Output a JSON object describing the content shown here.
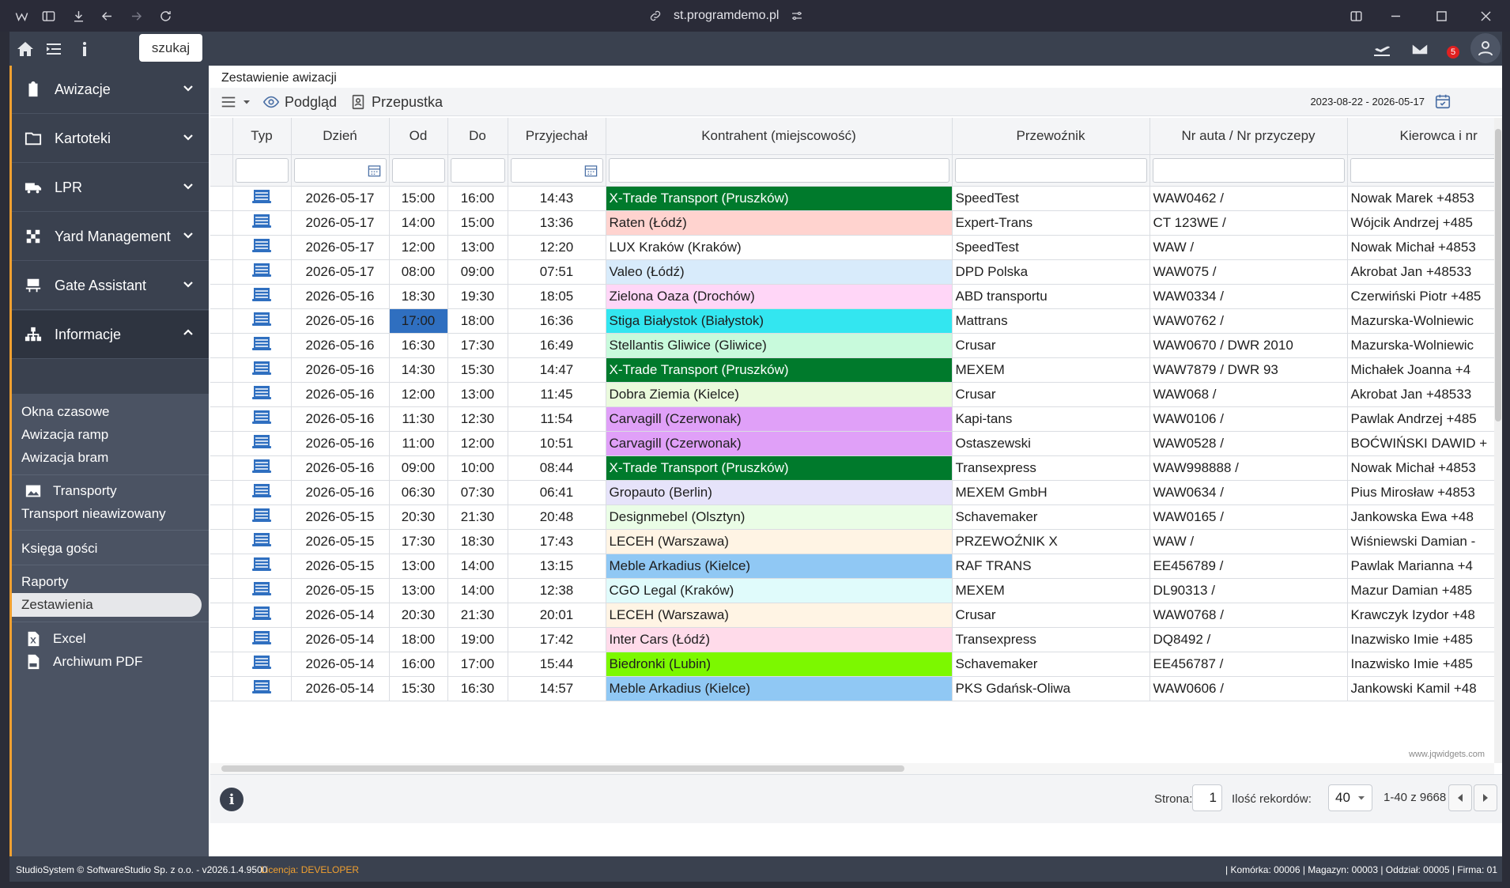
{
  "browser": {
    "url": "st.programdemo.pl"
  },
  "app": {
    "search_label": "szukaj",
    "mail_count": "5"
  },
  "sidebar": {
    "items": [
      {
        "label": "Awizacje"
      },
      {
        "label": "Kartoteki"
      },
      {
        "label": "LPR"
      },
      {
        "label": "Yard Management"
      },
      {
        "label": "Gate Assistant"
      },
      {
        "label": "Informacje"
      }
    ],
    "sub": {
      "okna": "Okna czasowe",
      "ramp": "Awizacja ramp",
      "bram": "Awizacja bram",
      "transporty": "Transporty",
      "nieawizowany": "Transport nieawizowany",
      "ksiega": "Księga gości",
      "raporty": "Raporty",
      "zestawienia": "Zestawienia",
      "excel": "Excel",
      "pdf": "Archiwum PDF"
    }
  },
  "main": {
    "title": "Zestawienie awizacji",
    "toolbar": {
      "podglad": "Podgląd",
      "przepustka": "Przepustka",
      "daterange": "2023-08-22 - 2026-05-17"
    },
    "columns": [
      "Typ",
      "Dzień",
      "Od",
      "Do",
      "Przyjechał",
      "Kontrahent (miejscowość)",
      "Przewoźnik",
      "Nr auta / Nr przyczepy",
      "Kierowca i nr"
    ],
    "rows": [
      [
        "2026-05-17",
        "15:00",
        "16:00",
        "14:43",
        "X-Trade Transport (Pruszków)",
        "SpeedTest",
        "WAW0462 /",
        "Nowak Marek +4853"
      ],
      [
        "2026-05-17",
        "14:00",
        "15:00",
        "13:36",
        "Raten (Łódź)",
        "Expert-Trans",
        "CT 123WE /",
        "Wójcik Andrzej +485"
      ],
      [
        "2026-05-17",
        "12:00",
        "13:00",
        "12:20",
        "LUX Kraków (Kraków)",
        "SpeedTest",
        "WAW /",
        "Nowak Michał +4853"
      ],
      [
        "2026-05-17",
        "08:00",
        "09:00",
        "07:51",
        "Valeo (Łódź)",
        "DPD Polska",
        "WAW075 /",
        "Akrobat Jan +48533"
      ],
      [
        "2026-05-16",
        "18:30",
        "19:30",
        "18:05",
        "Zielona Oaza (Drochów)",
        "ABD transportu",
        "WAW0334 /",
        "Czerwiński Piotr +485"
      ],
      [
        "2026-05-16",
        "17:00",
        "18:00",
        "16:36",
        "Stiga Białystok (Białystok)",
        "Mattrans",
        "WAW0762 /",
        "Mazurska-Wolniewic"
      ],
      [
        "2026-05-16",
        "16:30",
        "17:30",
        "16:49",
        "Stellantis Gliwice (Gliwice)",
        "Crusar",
        "WAW0670 / DWR 2010",
        "Mazurska-Wolniewic"
      ],
      [
        "2026-05-16",
        "14:30",
        "15:30",
        "14:47",
        "X-Trade Transport (Pruszków)",
        "MEXEM",
        "WAW7879 / DWR 93",
        "Michałek Joanna +4"
      ],
      [
        "2026-05-16",
        "12:00",
        "13:00",
        "11:45",
        "Dobra Ziemia (Kielce)",
        "Crusar",
        "WAW068 /",
        "Akrobat Jan +48533"
      ],
      [
        "2026-05-16",
        "11:30",
        "12:30",
        "11:54",
        "Carvagill (Czerwonak)",
        "Kapi-tans",
        "WAW0106 /",
        "Pawlak Andrzej +485"
      ],
      [
        "2026-05-16",
        "11:00",
        "12:00",
        "10:51",
        "Carvagill (Czerwonak)",
        "Ostaszewski",
        "WAW0528 /",
        "BOĆWIŃSKI DAWID +"
      ],
      [
        "2026-05-16",
        "09:00",
        "10:00",
        "08:44",
        "X-Trade Transport (Pruszków)",
        "Transexpress",
        "WAW998888 /",
        "Nowak Michał +4853"
      ],
      [
        "2026-05-16",
        "06:30",
        "07:30",
        "06:41",
        "Gropauto (Berlin)",
        "MEXEM GmbH",
        "WAW0634 /",
        "Pius Mirosław +4853"
      ],
      [
        "2026-05-15",
        "20:30",
        "21:30",
        "20:48",
        "Designmebel (Olsztyn)",
        "Schavemaker",
        "WAW0165 /",
        "Jankowska Ewa +48"
      ],
      [
        "2026-05-15",
        "17:30",
        "18:30",
        "17:43",
        "LECEH (Warszawa)",
        "PRZEWOŹNIK X",
        "WAW /",
        "Wiśniewski Damian -"
      ],
      [
        "2026-05-15",
        "13:00",
        "14:00",
        "13:15",
        "Meble Arkadius (Kielce)",
        "RAF TRANS",
        "EE456789 /",
        "Pawlak Marianna +4"
      ],
      [
        "2026-05-15",
        "13:00",
        "14:00",
        "12:38",
        "CGO Legal (Kraków)",
        "MEXEM",
        "DL90313 /",
        "Mazur Damian +485"
      ],
      [
        "2026-05-14",
        "20:30",
        "21:30",
        "20:01",
        "LECEH (Warszawa)",
        "Crusar",
        "WAW0768 /",
        "Krawczyk Izydor +48"
      ],
      [
        "2026-05-14",
        "18:00",
        "19:00",
        "17:42",
        "Inter Cars (Łódź)",
        "Transexpress",
        "DQ8492 /",
        "Inazwisko Imie +485"
      ],
      [
        "2026-05-14",
        "16:00",
        "17:00",
        "15:44",
        "Biedronki (Lubin)",
        "Schavemaker",
        "EE456787 /",
        "Inazwisko Imie +485"
      ],
      [
        "2026-05-14",
        "15:30",
        "16:30",
        "14:57",
        "Meble Arkadius (Kielce)",
        "PKS Gdańsk-Oliwa",
        "WAW0606 /",
        "Jankowski Kamil +48"
      ]
    ],
    "row_colors": [
      "#007a2c",
      "#ffd3cf",
      "#ffffff",
      "#d8ebfb",
      "#ffd6f7",
      "#33e6f0",
      "#c8fadc",
      "#007a2c",
      "#eafadc",
      "#e0a0f8",
      "#e0a0f8",
      "#007a2c",
      "#e6e3fa",
      "#eafde6",
      "#fff4e4",
      "#90c8f4",
      "#e0fbfb",
      "#fff4e4",
      "#ffdbea",
      "#7cf800",
      "#90c8f4"
    ],
    "selected_cell": {
      "row": 5,
      "column": "Od",
      "color": "#2f6fc0"
    },
    "watermark": "www.jqwidgets.com"
  },
  "pager": {
    "page_label": "Strona:",
    "page": "1",
    "records_label": "Ilość rekordów:",
    "records": "40",
    "range": "1-40 z 9668"
  },
  "status": {
    "copyright": "StudioSystem © SoftwareStudio Sp. z o.o. - v2026.1.4.9500",
    "license": "Licencja: DEVELOPER",
    "cells": "| Komórka: 00006 | Magazyn: 00003 | Oddział: 00005 | Firma: 01"
  },
  "colors": {
    "accent": "#f0a030",
    "sidebar": "#3a414f",
    "selected": "#2f6fc0",
    "license": "#f0a030"
  }
}
